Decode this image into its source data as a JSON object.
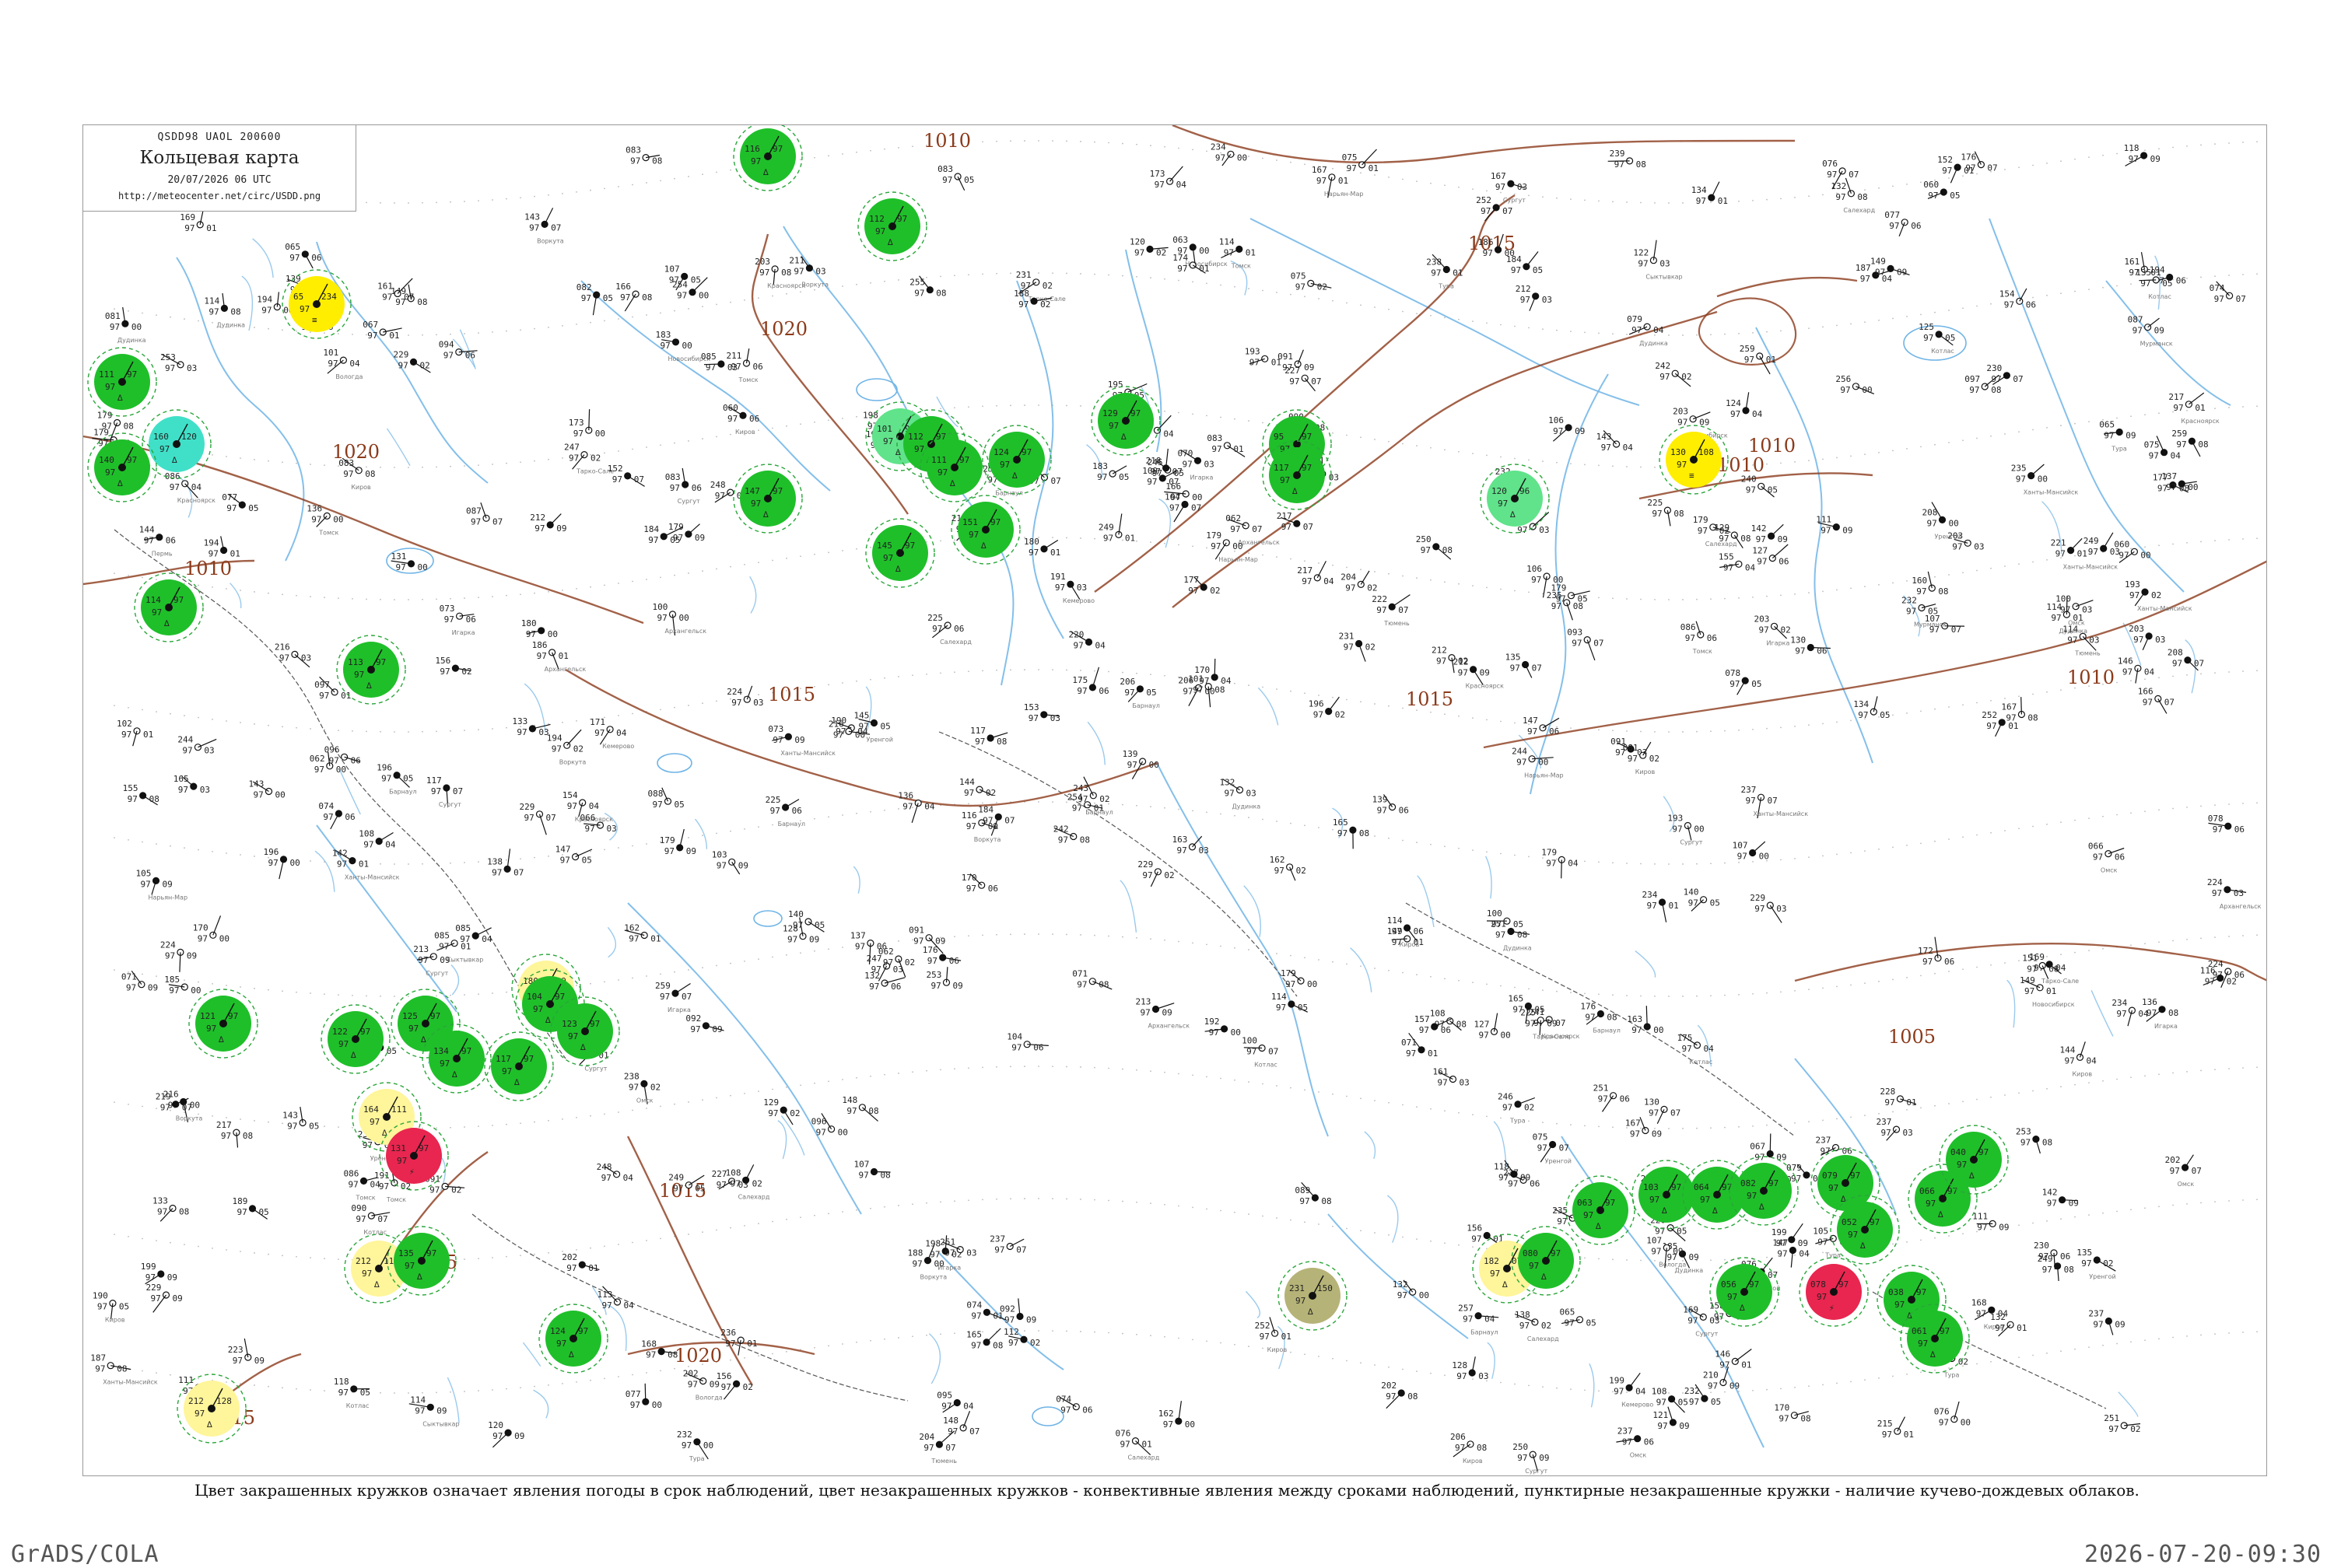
{
  "header": {
    "code": "QSDD98  UAOL  200600",
    "title": "Кольцевая карта",
    "datetime": "20/07/2026 06 UTC",
    "url": "http://meteocenter.net/circ/USDD.png"
  },
  "legend": {
    "caption": "Цвет закрашенных кружков означает явления погоды в срок наблюдений, цвет незакрашенных кружков - конвективные явления между сроками наблюдений, пунктирные незакрашенные кружки - наличие кучево-дождевых облаков."
  },
  "footer": {
    "software": "GrADS/COLA",
    "timestamp": "2026-07-20-09:30"
  },
  "colors": {
    "rain_fill": "#1fbf2a",
    "shower_fill": "#60e38a",
    "fog_fill": "#ffee00",
    "drizzle_fill": "#fff59a",
    "thunder_fill": "#e8264f",
    "haze_fill": "#40e0c8",
    "dust_fill": "#b5b377",
    "cb_ring": "#2aa63a",
    "thunder_ring": "#d0306a",
    "isobar": "#8b3a1a",
    "river": "#6fb4e6",
    "border": "#555555"
  },
  "isobars": [
    {
      "label": "1010"
    },
    {
      "label": "1015"
    },
    {
      "label": "1020"
    },
    {
      "label": "1020"
    },
    {
      "label": "1010"
    },
    {
      "label": "1015"
    },
    {
      "label": "1020"
    },
    {
      "label": "1015"
    },
    {
      "label": "1010"
    },
    {
      "label": "1005"
    },
    {
      "label": "1015"
    },
    {
      "label": "1015"
    },
    {
      "label": "1010"
    },
    {
      "label": "1015"
    },
    {
      "label": "1010"
    }
  ],
  "stations": [
    {
      "type": "rain",
      "t": "116",
      "p": "97"
    },
    {
      "type": "rain",
      "t": "112",
      "p": "97"
    },
    {
      "type": "fog",
      "t": "65",
      "p": "234"
    },
    {
      "type": "rain",
      "t": "111",
      "p": "97"
    },
    {
      "type": "haze",
      "t": "160",
      "p": "120"
    },
    {
      "type": "rain",
      "t": "140",
      "p": "97"
    },
    {
      "type": "rain",
      "t": "147",
      "p": "97"
    },
    {
      "type": "rain",
      "t": "145",
      "p": "97"
    },
    {
      "type": "rain",
      "t": "114",
      "p": "97"
    },
    {
      "type": "rain",
      "t": "113",
      "p": "97"
    },
    {
      "type": "shower",
      "t": "101",
      "p": "93"
    },
    {
      "type": "rain",
      "t": "112",
      "p": "97"
    },
    {
      "type": "rain",
      "t": "111",
      "p": "97"
    },
    {
      "type": "rain",
      "t": "124",
      "p": "97"
    },
    {
      "type": "rain",
      "t": "151",
      "p": "97"
    },
    {
      "type": "rain",
      "t": "129",
      "p": "97"
    },
    {
      "type": "rain",
      "t": "95",
      "p": "97"
    },
    {
      "type": "rain",
      "t": "117",
      "p": "97"
    },
    {
      "type": "shower",
      "t": "120",
      "p": "96"
    },
    {
      "type": "fog",
      "t": "130",
      "p": "108"
    },
    {
      "type": "drizzle",
      "t": "180",
      "p": "119"
    },
    {
      "type": "rain",
      "t": "122",
      "p": "97"
    },
    {
      "type": "rain",
      "t": "125",
      "p": "97"
    },
    {
      "type": "rain",
      "t": "134",
      "p": "97"
    },
    {
      "type": "rain",
      "t": "117",
      "p": "97"
    },
    {
      "type": "rain",
      "t": "104",
      "p": "97"
    },
    {
      "type": "rain",
      "t": "123",
      "p": "97"
    },
    {
      "type": "rain",
      "t": "121",
      "p": "97"
    },
    {
      "type": "drizzle",
      "t": "164",
      "p": "111"
    },
    {
      "type": "thunder",
      "t": "131",
      "p": "97"
    },
    {
      "type": "drizzle",
      "t": "212",
      "p": "117"
    },
    {
      "type": "rain",
      "t": "135",
      "p": "97"
    },
    {
      "type": "drizzle",
      "t": "212",
      "p": "128"
    },
    {
      "type": "rain",
      "t": "124",
      "p": "97"
    },
    {
      "type": "dust",
      "t": "231",
      "p": "150"
    },
    {
      "type": "drizzle",
      "t": "182",
      "p": "075"
    },
    {
      "type": "rain",
      "t": "080",
      "p": "97"
    },
    {
      "type": "rain",
      "t": "063",
      "p": "97"
    },
    {
      "type": "rain",
      "t": "103",
      "p": "97"
    },
    {
      "type": "rain",
      "t": "064",
      "p": "97"
    },
    {
      "type": "rain",
      "t": "082",
      "p": "97"
    },
    {
      "type": "rain",
      "t": "079",
      "p": "97"
    },
    {
      "type": "rain",
      "t": "052",
      "p": "97"
    },
    {
      "type": "rain",
      "t": "066",
      "p": "97"
    },
    {
      "type": "rain",
      "t": "040",
      "p": "97"
    },
    {
      "type": "rain",
      "t": "038",
      "p": "97"
    },
    {
      "type": "rain",
      "t": "056",
      "p": "97"
    },
    {
      "type": "thunder",
      "t": "078",
      "p": "97"
    },
    {
      "type": "rain",
      "t": "061",
      "p": "97"
    }
  ],
  "station_names": [
    "Мурманск",
    "Архангельск",
    "Нарьян-Мар",
    "Воркута",
    "Салехард",
    "Сыктывкар",
    "Котлас",
    "Вологда",
    "Киров",
    "Пермь",
    "Ханты-Мансийск",
    "Сургут",
    "Тюмень",
    "Омск",
    "Томск",
    "Новосибирск",
    "Кемерово",
    "Барнаул",
    "Красноярск",
    "Тура",
    "Дудинка",
    "Игарка",
    "Тарко-Сале",
    "Уренгой"
  ]
}
